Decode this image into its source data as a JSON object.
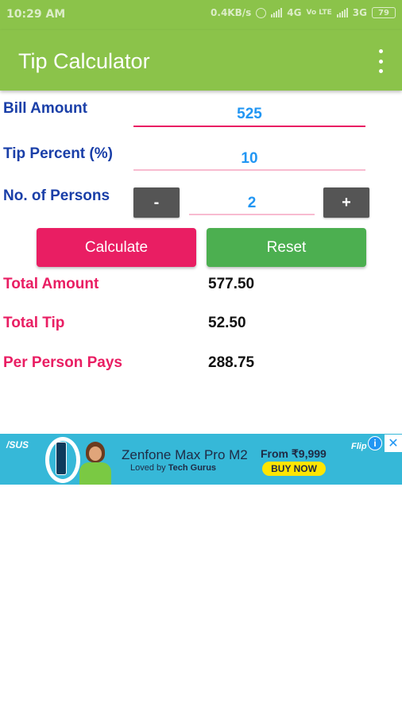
{
  "status": {
    "time": "10:29 AM",
    "speed": "0.4KB/s",
    "net1": "4G",
    "volte": "Vo LTE",
    "net2": "3G",
    "battery": "79"
  },
  "app": {
    "title": "Tip Calculator"
  },
  "form": {
    "bill_label": "Bill Amount",
    "bill_value": "525",
    "tip_label": "Tip Percent (%)",
    "tip_value": "10",
    "persons_label": "No. of Persons",
    "persons_value": "2",
    "minus": "-",
    "plus": "+"
  },
  "buttons": {
    "calculate": "Calculate",
    "reset": "Reset"
  },
  "results": {
    "total_amount_label": "Total Amount",
    "total_amount_value": "577.50",
    "total_tip_label": "Total Tip",
    "total_tip_value": "52.50",
    "per_person_label": "Per Person Pays",
    "per_person_value": "288.75"
  },
  "ad": {
    "brand": "/SUS",
    "model": "Zenfone Max Pro M2",
    "tagline_prefix": "Loved by",
    "tagline_bold": "Tech Gurus",
    "price": "From ₹9,999",
    "cta": "BUY NOW",
    "partner": "Flip",
    "info": "i",
    "close": "✕"
  },
  "colors": {
    "appbar": "#8bc34a",
    "label_blue": "#1a3fa8",
    "value_blue": "#2196f3",
    "accent_pink": "#e91e63",
    "reset_green": "#4caf50",
    "stepper_grey": "#555555",
    "ad_bg": "#36b8d8"
  }
}
